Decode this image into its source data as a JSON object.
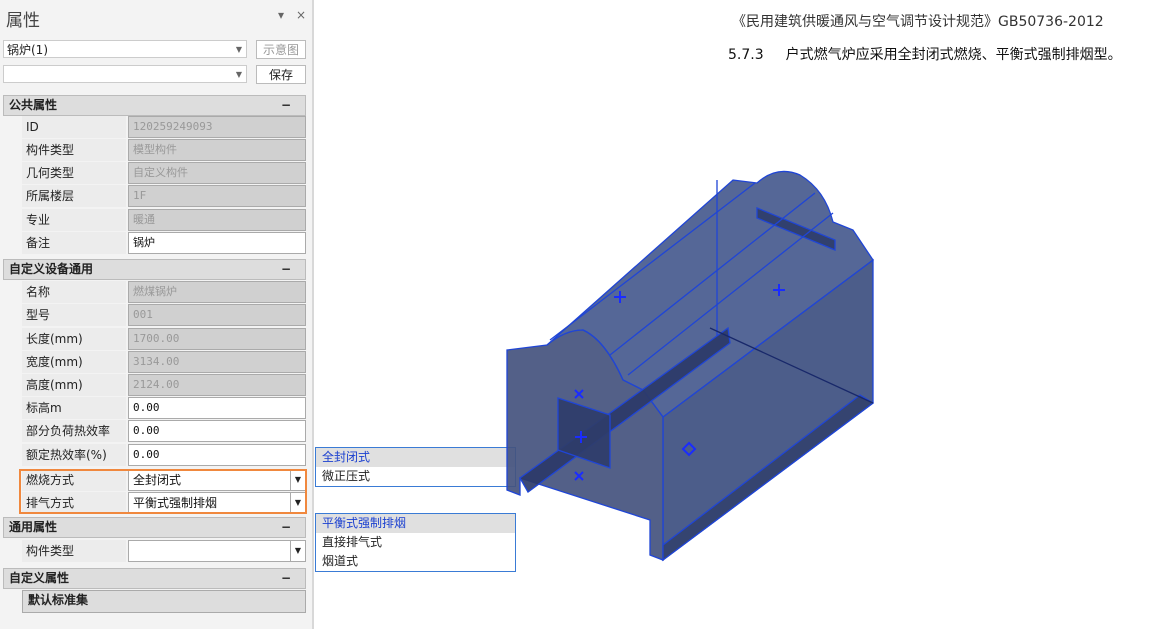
{
  "panel": {
    "title": "属性",
    "pin": "▾",
    "close": "×",
    "selector": "锅炉(1)",
    "preset": "",
    "diagram_btn": "示意图",
    "save_btn": "保存"
  },
  "sections": {
    "public": {
      "title": "公共属性",
      "collapse": "−",
      "rows": [
        {
          "label": "ID",
          "value": "120259249093"
        },
        {
          "label": "构件类型",
          "value": "模型构件"
        },
        {
          "label": "几何类型",
          "value": "自定义构件"
        },
        {
          "label": "所属楼层",
          "value": "1F"
        },
        {
          "label": "专业",
          "value": "暖通"
        },
        {
          "label": "备注",
          "value": "锅炉"
        }
      ]
    },
    "custom_equip": {
      "title": "自定义设备通用",
      "collapse": "−",
      "rows": [
        {
          "label": "名称",
          "value": "燃煤锅炉"
        },
        {
          "label": "型号",
          "value": "001"
        },
        {
          "label": "长度(mm)",
          "value": "1700.00"
        },
        {
          "label": "宽度(mm)",
          "value": "3134.00"
        },
        {
          "label": "高度(mm)",
          "value": "2124.00"
        },
        {
          "label": "标高m",
          "value": "0.00"
        },
        {
          "label": "部分负荷热效率(%)",
          "value": "0.00"
        },
        {
          "label": "额定热效率(%)",
          "value": "0.00"
        },
        {
          "label": "燃烧方式",
          "value": "全封闭式"
        },
        {
          "label": "排气方式",
          "value": "平衡式强制排烟"
        }
      ]
    },
    "general": {
      "title": "通用属性",
      "collapse": "−",
      "rows": [
        {
          "label": "构件类型",
          "value": ""
        }
      ]
    },
    "custom": {
      "title": "自定义属性",
      "collapse": "−",
      "sub": "默认标准集"
    }
  },
  "popups": {
    "combustion": [
      "全封闭式",
      "微正压式"
    ],
    "exhaust": [
      "平衡式强制排烟",
      "直接排气式",
      "烟道式"
    ]
  },
  "reference": {
    "standard": "《民用建筑供暖通风与空气调节设计规范》GB50736-2012",
    "clause_no": "5.7.3",
    "clause": "户式燃气炉应采用全封闭式燃烧、平衡式强制排烟型。"
  },
  "colors": {
    "model_fill": "#3d4f80",
    "model_edge": "#1f45d6",
    "highlight": "#f0883e"
  }
}
